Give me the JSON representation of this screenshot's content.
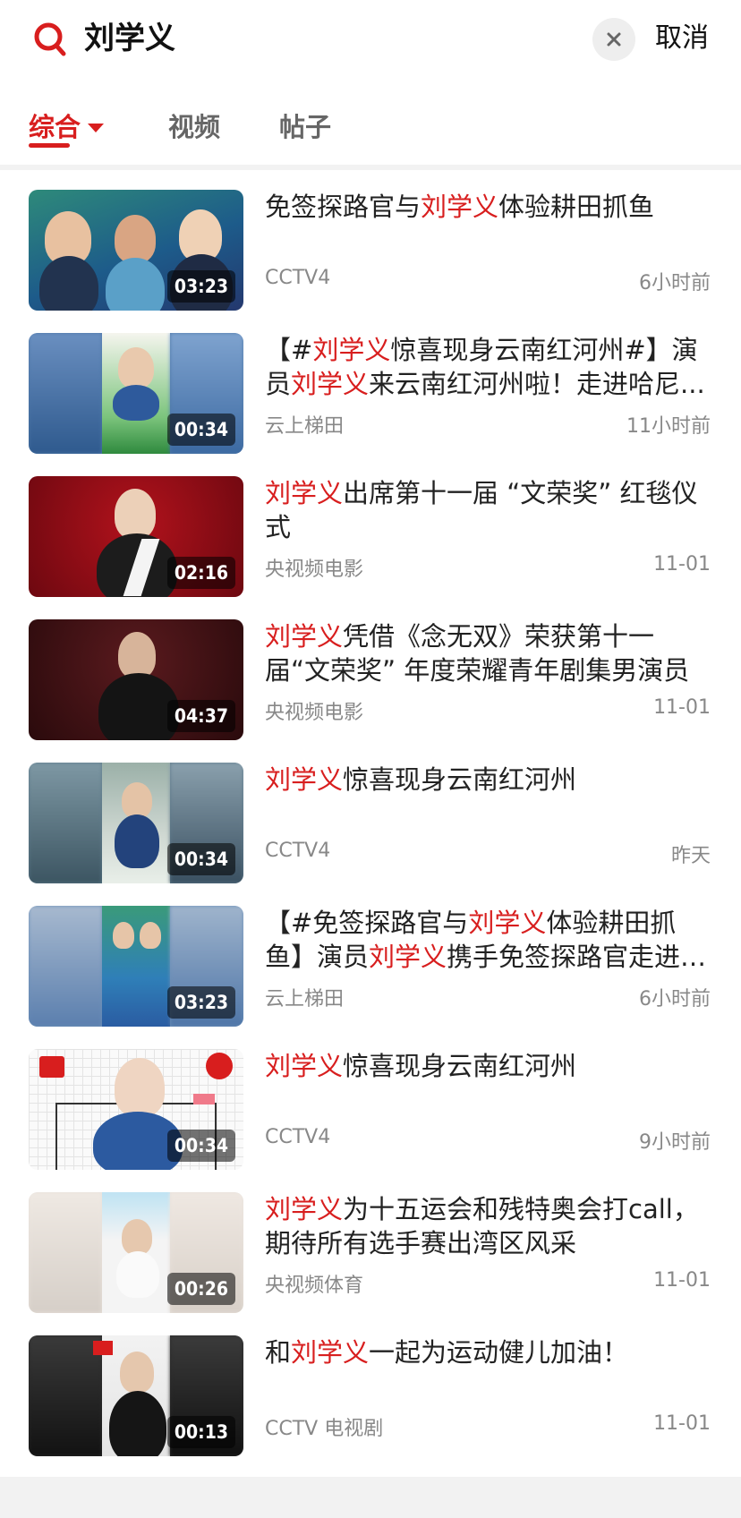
{
  "header": {
    "query": "刘学义",
    "cancel_label": "取消"
  },
  "tabs": [
    {
      "label": "综合",
      "active": true
    },
    {
      "label": "视频",
      "active": false
    },
    {
      "label": "帖子",
      "active": false
    }
  ],
  "items": [
    {
      "title_parts": [
        "免签探路官与",
        "刘学义",
        "体验耕田抓鱼"
      ],
      "source": "CCTV4",
      "time": "6小时前",
      "duration": "03:23"
    },
    {
      "title_parts": [
        "【#",
        "刘学义",
        "惊喜现身云南红河州#】演员",
        "刘学义",
        "来云南红河州啦！走进哈尼..."
      ],
      "source": "云上梯田",
      "time": "11小时前",
      "duration": "00:34"
    },
    {
      "title_parts": [
        "",
        "刘学义",
        "出席第十一届 “文荣奖” 红毯仪式"
      ],
      "source": "央视频电影",
      "time": "11-01",
      "duration": "02:16"
    },
    {
      "title_parts": [
        "",
        "刘学义",
        "凭借《念无双》荣获第十一届“文荣奖” 年度荣耀青年剧集男演员"
      ],
      "source": "央视频电影",
      "time": "11-01",
      "duration": "04:37"
    },
    {
      "title_parts": [
        "",
        "刘学义",
        "惊喜现身云南红河州"
      ],
      "source": "CCTV4",
      "time": "昨天",
      "duration": "00:34"
    },
    {
      "title_parts": [
        "【#免签探路官与",
        "刘学义",
        "体验耕田抓鱼】演员",
        "刘学义",
        "携手免签探路官走进红..."
      ],
      "source": "云上梯田",
      "time": "6小时前",
      "duration": "03:23"
    },
    {
      "title_parts": [
        "",
        "刘学义",
        "惊喜现身云南红河州"
      ],
      "source": "CCTV4",
      "time": "9小时前",
      "duration": "00:34"
    },
    {
      "title_parts": [
        "",
        "刘学义",
        "为十五运会和残特奥会打call，期待所有选手赛出湾区风采"
      ],
      "source": "央视频体育",
      "time": "11-01",
      "duration": "00:26"
    },
    {
      "title_parts": [
        "和",
        "刘学义",
        "一起为运动健儿加油！"
      ],
      "source": "CCTV 电视剧",
      "time": "11-01",
      "duration": "00:13"
    }
  ],
  "colors": {
    "accent": "#d81e1e",
    "muted": "#888888"
  }
}
